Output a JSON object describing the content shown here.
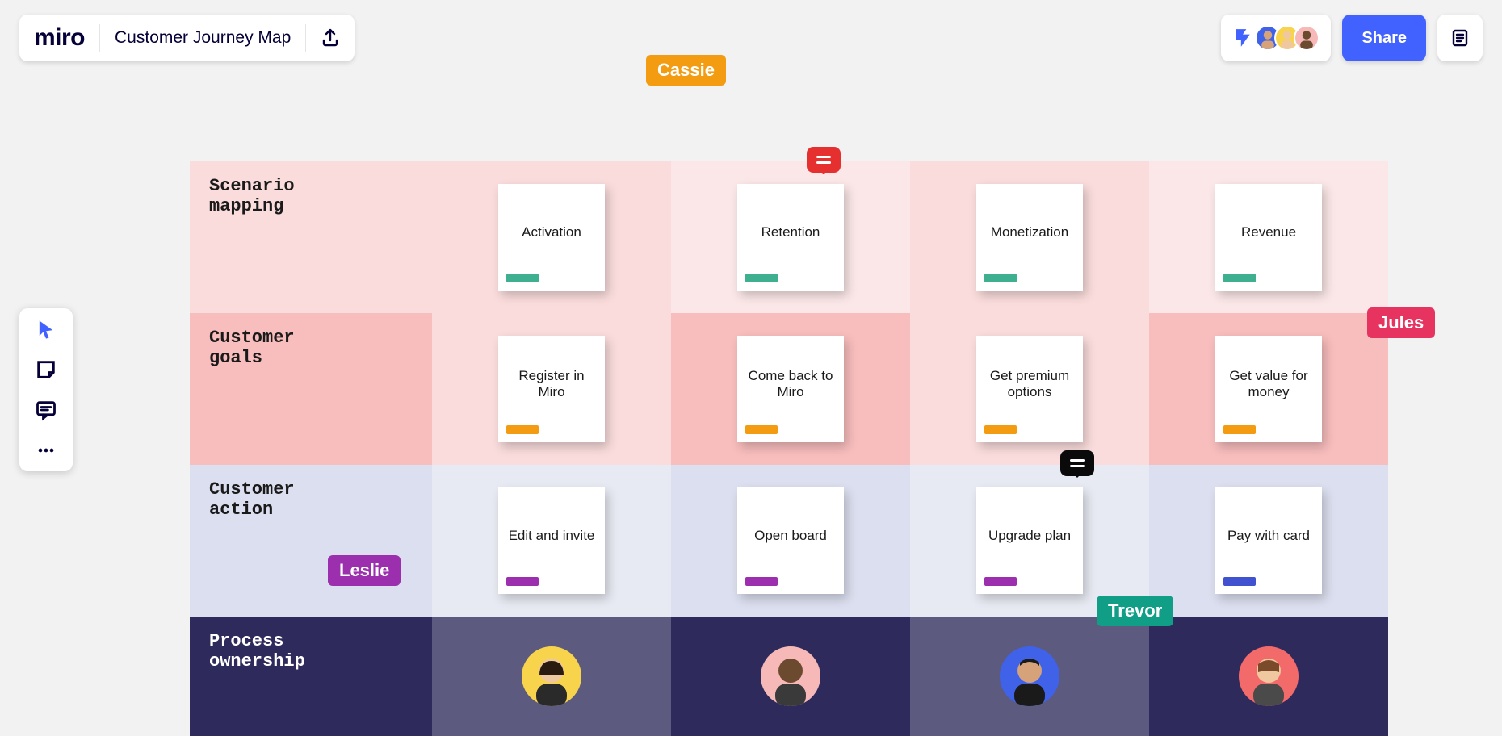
{
  "app": {
    "logo": "miro"
  },
  "board": {
    "title": "Customer Journey Map"
  },
  "topbar": {
    "share_label": "Share"
  },
  "cursors": {
    "cassie": {
      "name": "Cassie",
      "color": "#f39c12"
    },
    "jules": {
      "name": "Jules",
      "color": "#e7335f"
    },
    "leslie": {
      "name": "Leslie",
      "color": "#9b2fae"
    },
    "trevor": {
      "name": "Trevor",
      "color": "#119e87"
    }
  },
  "rows": {
    "scenario": {
      "label": "Scenario\nmapping",
      "tag_color": "#3fb08f",
      "cards": [
        "Activation",
        "Retention",
        "Monetization",
        "Revenue"
      ]
    },
    "goals": {
      "label": "Customer\ngoals",
      "tag_color": "#f39c12",
      "cards": [
        "Register in Miro",
        "Come back to Miro",
        "Get premium options",
        "Get value for money"
      ]
    },
    "action": {
      "label": "Customer\naction",
      "tag_color_a": "#9b2fae",
      "tag_color_b": "#4052cf",
      "cards": [
        "Edit and invite",
        "Open board",
        "Upgrade plan",
        "Pay with card"
      ]
    },
    "ownership": {
      "label": "Process\nownership"
    }
  },
  "owners": [
    {
      "bg": "#f8d34c"
    },
    {
      "bg": "#f7b8b8"
    },
    {
      "bg": "#3f62e8"
    },
    {
      "bg": "#f36a6a"
    }
  ],
  "collaborators": [
    {
      "bg": "#f8d34c"
    },
    {
      "bg": "#f8d34c"
    },
    {
      "bg": "#f7b8b8"
    }
  ],
  "comments": {
    "red": "#e63030",
    "black": "#0a0a0a"
  }
}
